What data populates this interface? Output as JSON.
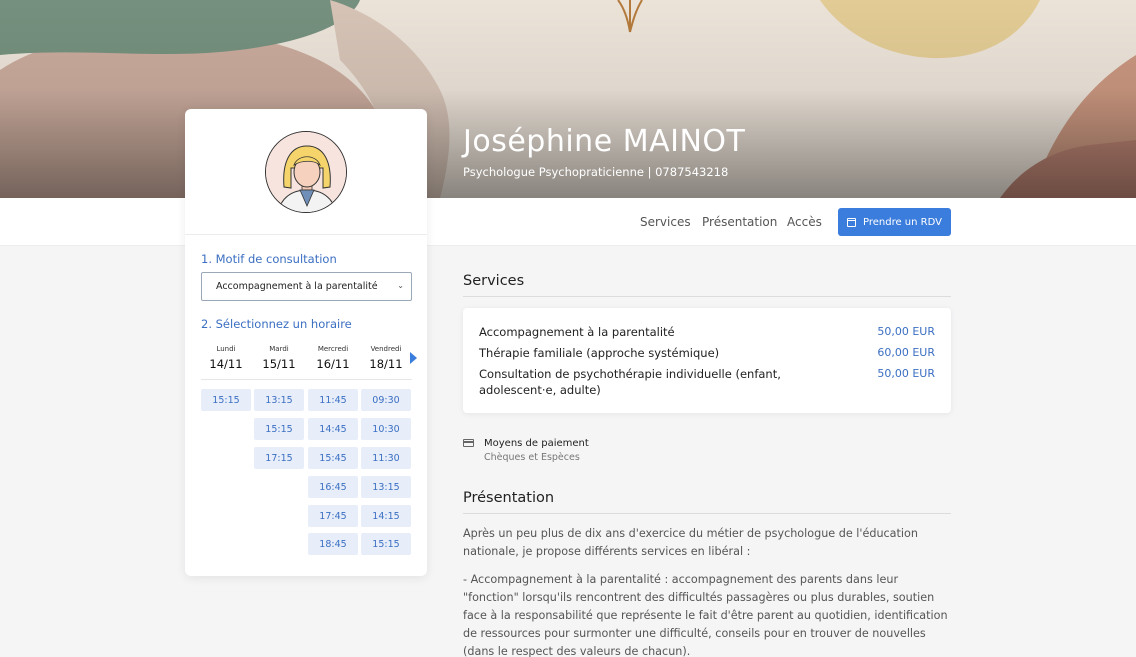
{
  "profile": {
    "name": "Joséphine MAINOT",
    "subtitle": "Psychologue Psychopraticienne | 0787543218"
  },
  "nav": {
    "links": [
      "Services",
      "Présentation",
      "Accès"
    ],
    "cta_label": "Prendre un RDV",
    "cta_icon": "calendar-icon"
  },
  "booking": {
    "step1_label": "1. Motif de consultation",
    "selected_reason": "Accompagnement à la parentalité",
    "step2_label": "2. Sélectionnez un horaire",
    "days": [
      {
        "name": "Lundi",
        "date": "14/11",
        "slots": [
          "15:15"
        ]
      },
      {
        "name": "Mardi",
        "date": "15/11",
        "slots": [
          "13:15",
          "15:15",
          "17:15"
        ]
      },
      {
        "name": "Mercredi",
        "date": "16/11",
        "slots": [
          "11:45",
          "14:45",
          "15:45",
          "16:45",
          "17:45",
          "18:45"
        ]
      },
      {
        "name": "Vendredi",
        "date": "18/11",
        "slots": [
          "09:30",
          "10:30",
          "11:30",
          "13:15",
          "14:15",
          "15:15"
        ]
      }
    ]
  },
  "services": {
    "title": "Services",
    "items": [
      {
        "name": "Accompagnement à la parentalité",
        "price": "50,00 EUR"
      },
      {
        "name": "Thérapie familiale (approche systémique)",
        "price": "60,00 EUR"
      },
      {
        "name": "Consultation de psychothérapie individuelle (enfant, adolescent·e, adulte)",
        "price": "50,00 EUR"
      }
    ]
  },
  "payment": {
    "icon": "credit-card-icon",
    "title": "Moyens de paiement",
    "methods": "Chèques et Espèces"
  },
  "presentation": {
    "title": "Présentation",
    "paragraphs": [
      "Après un peu plus de dix ans d'exercice du métier de psychologue de l'éducation nationale, je propose différents services en libéral :",
      "- Accompagnement à la parentalité : accompagnement des parents dans leur \"fonction\" lorsqu'ils rencontrent des difficultés passagères ou plus durables, soutien face à la responsabilité que représente le fait d'être parent au quotidien, identification de ressources pour surmonter une difficulté, conseils pour en trouver de nouvelles (dans le respect des valeurs de chacun)."
    ]
  },
  "colors": {
    "accent": "#3b7ddd",
    "link": "#3b6fc2",
    "slot_bg": "#e7eefa"
  }
}
